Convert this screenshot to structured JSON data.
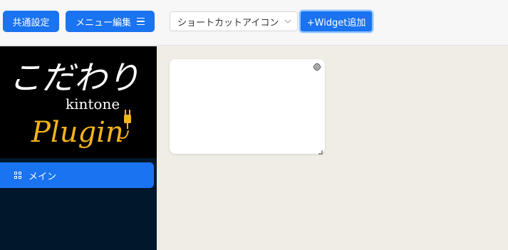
{
  "toolbar": {
    "common_settings_label": "共通設定",
    "menu_edit_label": "メニュー編集",
    "shortcut_select_value": "ショートカットアイコン",
    "add_widget_label": "+Widget追加"
  },
  "sidebar": {
    "logo": {
      "line1": "こだわり",
      "line2": "kintone",
      "line3": "Plugin"
    },
    "items": [
      {
        "label": "メイン",
        "icon": "grid-icon",
        "active": true
      }
    ]
  },
  "colors": {
    "accent": "#1a73f0",
    "sidebar_bg": "#00172c",
    "logo_bg": "#000000",
    "logo_gold": "#f2b31b",
    "main_bg": "#f0ede6"
  },
  "widget": {
    "settings_icon": "gear-icon",
    "resize_icon": "resize-handle-icon"
  }
}
